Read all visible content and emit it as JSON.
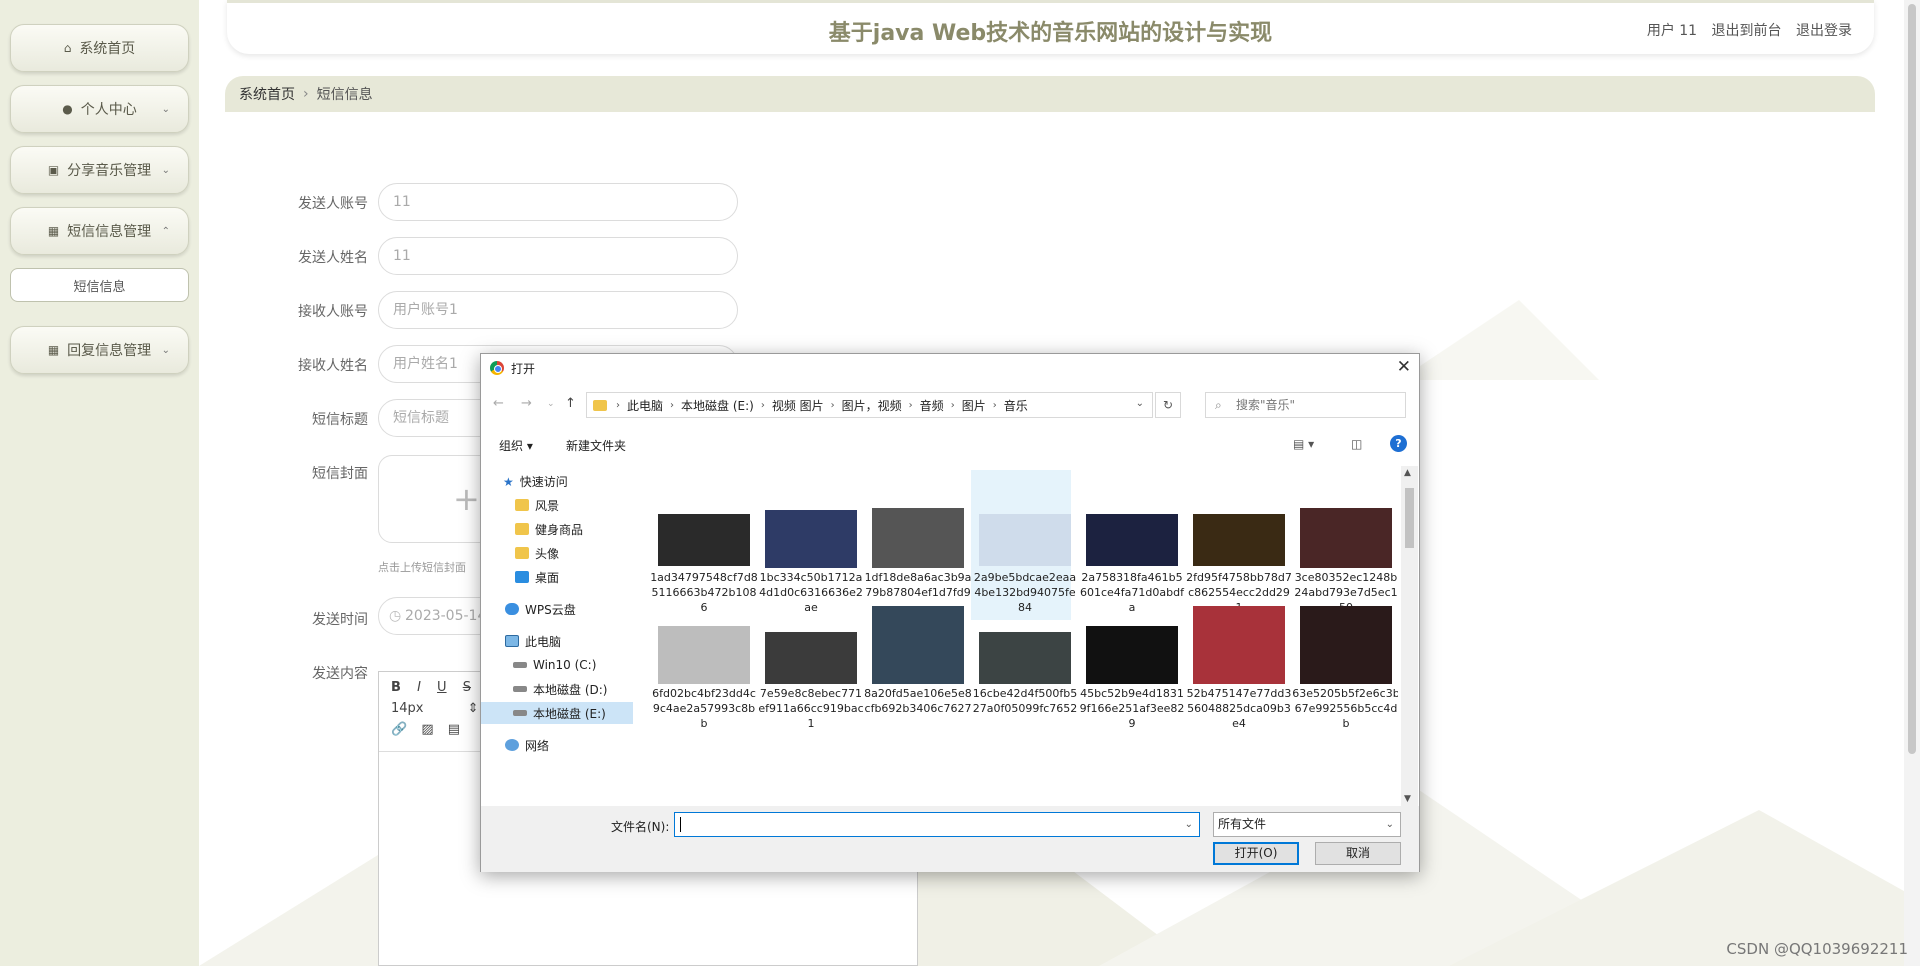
{
  "sidebar": {
    "items": [
      {
        "label": "系统首页",
        "icon": "home-icon"
      },
      {
        "label": "个人中心",
        "icon": "user-icon"
      },
      {
        "label": "分享音乐管理",
        "icon": "clipboard-icon"
      },
      {
        "label": "短信信息管理",
        "icon": "grid-icon"
      },
      {
        "label": "短信信息",
        "icon": ""
      },
      {
        "label": "回复信息管理",
        "icon": "grid-icon"
      }
    ]
  },
  "header": {
    "title": "基于java Web技术的音乐网站的设计与实现",
    "user": "用户 11",
    "to_front": "退出到前台",
    "logout": "退出登录"
  },
  "breadcrumb": {
    "home": "系统首页",
    "sep": "›",
    "current": "短信信息"
  },
  "form": {
    "sender_account_label": "发送人账号",
    "sender_account_value": "11",
    "sender_name_label": "发送人姓名",
    "sender_name_value": "11",
    "receiver_account_label": "接收人账号",
    "receiver_account_placeholder": "用户账号1",
    "receiver_name_label": "接收人姓名",
    "receiver_name_placeholder": "用户姓名1",
    "title_label": "短信标题",
    "title_placeholder": "短信标题",
    "cover_label": "短信封面",
    "cover_tip": "点击上传短信封面",
    "time_label": "发送时间",
    "time_value": "2023-05-14",
    "content_label": "发送内容",
    "font_size": "14px"
  },
  "dialog": {
    "title": "打开",
    "path": [
      "此电脑",
      "本地磁盘 (E:)",
      "视频 图片",
      "图片，视频",
      "音频",
      "图片",
      "音乐"
    ],
    "search_placeholder": "搜索\"音乐\"",
    "organize": "组织 ▾",
    "new_folder": "新建文件夹",
    "tree": [
      {
        "label": "快速访问",
        "icon": "star"
      },
      {
        "label": "风景",
        "icon": "folder"
      },
      {
        "label": "健身商品",
        "icon": "folder"
      },
      {
        "label": "头像",
        "icon": "folder"
      },
      {
        "label": "桌面",
        "icon": "desktop"
      },
      {
        "label": "WPS云盘",
        "icon": "cloud"
      },
      {
        "label": "此电脑",
        "icon": "pc"
      },
      {
        "label": "Win10 (C:)",
        "icon": "drive"
      },
      {
        "label": "本地磁盘 (D:)",
        "icon": "drive"
      },
      {
        "label": "本地磁盘 (E:)",
        "icon": "drive"
      },
      {
        "label": "网络",
        "icon": "net"
      }
    ],
    "files": [
      {
        "name": "1ad34797548cf7d85116663b472b1086",
        "color": "#2a2a2a"
      },
      {
        "name": "1bc334c50b1712a4d1d0c6316636e2ae",
        "color": "#2e3b66"
      },
      {
        "name": "1df18de8a6ac3b9a79b87804ef1d7fd9",
        "color": "#555555"
      },
      {
        "name": "2a9be5bdcae2eaa4be132bd94075fe84",
        "color": "#cfdceb"
      },
      {
        "name": "2a758318fa461b5601ce4fa71d0abdfa",
        "color": "#1c2240"
      },
      {
        "name": "2fd95f4758bb78d7c862554ecc2dd291",
        "color": "#3a2a14"
      },
      {
        "name": "3ce80352ec1248b24abd793e7d5ec150",
        "color": "#4a2626"
      },
      {
        "name": "6fd02bc4bf23dd4c9c4ae2a57993c8bb",
        "color": "#bdbdbd"
      },
      {
        "name": "7e59e8c8ebec771ef911a66cc919bac1",
        "color": "#3b3b3b"
      },
      {
        "name": "8a20fd5ae106e5e8cfb692b3406c7627",
        "color": "#34485a"
      },
      {
        "name": "16cbe42d4f500fb527a0f05099fc7652",
        "color": "#3c4444"
      },
      {
        "name": "45bc52b9e4d18319f166e251af3ee829",
        "color": "#111111"
      },
      {
        "name": "52b475147e77dd356048825dca09b3e4",
        "color": "#a8323a"
      },
      {
        "name": "63e5205b5f2e6c3b67e992556b5cc4db",
        "color": "#2a1a1a"
      }
    ],
    "filename_label": "文件名(N):",
    "filename_value": "",
    "filetype": "所有文件",
    "open_button": "打开(O)",
    "cancel_button": "取消"
  },
  "watermark": "CSDN @QQ1039692211",
  "colors": {
    "sidebar_bg": "#eceedf",
    "title": "#8a8a6a",
    "accent_blue": "#0078d7"
  }
}
